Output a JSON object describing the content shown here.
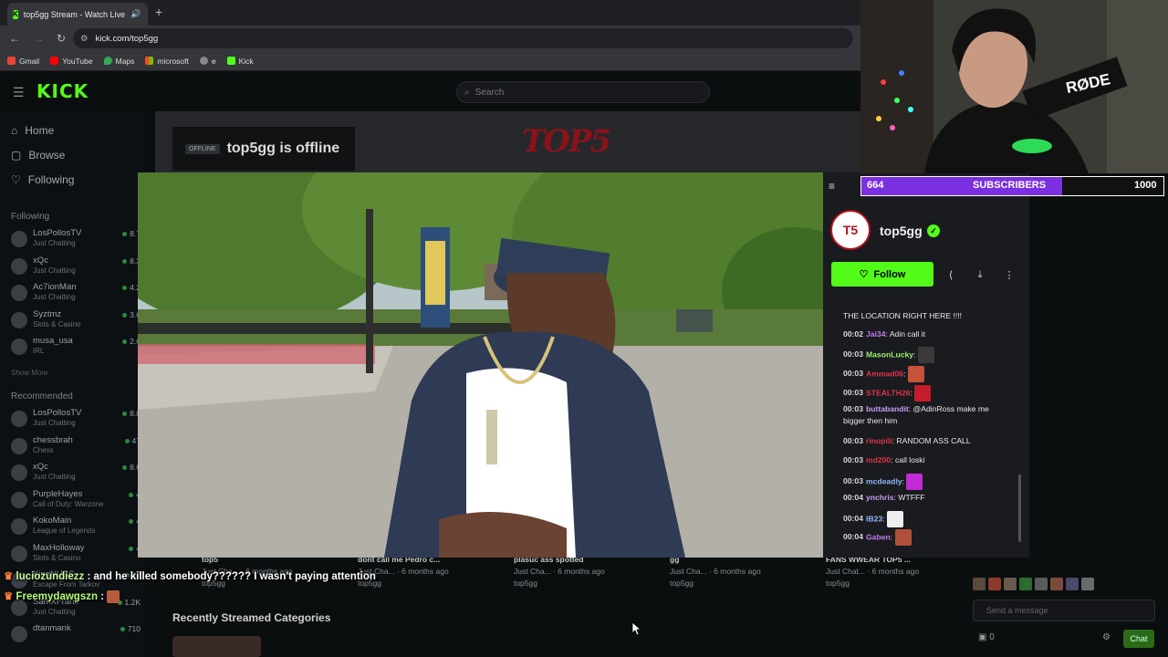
{
  "browser": {
    "tab_title": "top5gg Stream - Watch Live",
    "tab_close": "✕",
    "new_tab": "+",
    "url": "kick.com/top5gg",
    "bookmarks": [
      "Gmail",
      "YouTube",
      "Maps",
      "microsoft",
      "e",
      "Kick"
    ]
  },
  "kick": {
    "logo": "KICK",
    "search_placeholder": "Search",
    "nav": [
      "Home",
      "Browse",
      "Following"
    ],
    "following_title": "Following",
    "following": [
      {
        "name": "LosPollosTV",
        "sub": "Just Chatting",
        "viewers": "8.7"
      },
      {
        "name": "xQc",
        "sub": "Just Chatting",
        "viewers": "8.3"
      },
      {
        "name": "Ac7ionMan",
        "sub": "Just Chatting",
        "viewers": "4.2"
      },
      {
        "name": "Syztmz",
        "sub": "Slots & Casino",
        "viewers": "3.6"
      },
      {
        "name": "musa_usa",
        "sub": "IRL",
        "viewers": "2.6"
      }
    ],
    "show_more": "Show More",
    "recommended_title": "Recommended",
    "recommended": [
      {
        "name": "LosPollosTV",
        "sub": "Just Chatting",
        "viewers": "8.8"
      },
      {
        "name": "chessbrah",
        "sub": "Chess",
        "viewers": "47"
      },
      {
        "name": "xQc",
        "sub": "Just Chatting",
        "viewers": "8.6"
      },
      {
        "name": "PurpleHayes",
        "sub": "Call of Duty: Warzone",
        "viewers": "4"
      },
      {
        "name": "KokoMain",
        "sub": "League of Legends",
        "viewers": "4"
      },
      {
        "name": "MaxHolloway",
        "sub": "Slots & Casino",
        "viewers": "4"
      },
      {
        "name": "KingNUBS",
        "sub": "Escape From Tarkov",
        "viewers": "17"
      },
      {
        "name": "SamXFrank",
        "sub": "Just Chatting",
        "viewers": "1.2K"
      },
      {
        "name": "dtanmank",
        "sub": "",
        "viewers": "710"
      }
    ],
    "offline_tag": "OFFLINE",
    "offline_text": "top5gg is offline",
    "banner_logo": "TOP5",
    "recent_title": "Recently Streamed Categories"
  },
  "panel": {
    "collapse_icon": "≡",
    "avatar_text": "T5",
    "channel": "top5gg",
    "verified": "✓",
    "follow_label": "Follow",
    "chat": [
      {
        "ts": "",
        "user": "",
        "color": "#e9e9e9",
        "text": "THE LOCATION RIGHT HERE !!!!"
      },
      {
        "ts": "00:02",
        "user": "Jai34",
        "color": "#c17cf0",
        "text": "Adin call it"
      },
      {
        "ts": "00:03",
        "user": "MasonLucky",
        "color": "#9ef06a",
        "text": ""
      },
      {
        "ts": "00:03",
        "user": "Ammad06",
        "color": "#e0344a",
        "text": ""
      },
      {
        "ts": "00:03",
        "user": "STEALTH26",
        "color": "#e0344a",
        "text": ""
      },
      {
        "ts": "00:03",
        "user": "buttabandit",
        "color": "#c99cf5",
        "text": "@AdinRoss make me bigger then him"
      },
      {
        "ts": "00:03",
        "user": "rinopili",
        "color": "#e0344a",
        "text": "RANDOM ASS CALL"
      },
      {
        "ts": "00:03",
        "user": "md200",
        "color": "#e0344a",
        "text": "call loski"
      },
      {
        "ts": "00:03",
        "user": "mcdeadly",
        "color": "#8fb7ff",
        "text": ""
      },
      {
        "ts": "00:04",
        "user": "ynchris",
        "color": "#c99cf5",
        "text": "WTFFF"
      },
      {
        "ts": "00:04",
        "user": "IB23",
        "color": "#8fb7ff",
        "text": ""
      },
      {
        "ts": "00:04",
        "user": "Gaben",
        "color": "#c17cf0",
        "text": ""
      }
    ],
    "send_placeholder": "Send a message",
    "chat_button": "Chat",
    "points": "0"
  },
  "subs": {
    "current": "664",
    "label": "SUBSCRIBERS",
    "goal": "1000",
    "progress": 0.664
  },
  "videos": [
    {
      "title": "top5",
      "meta": "Just Cha... · 6 months ago",
      "channel": "top5gg"
    },
    {
      "title": "dont call me Pedro c...",
      "meta": "Just Cha... · 6 months ago",
      "channel": "top5gg"
    },
    {
      "title": "plasuc ass spotted",
      "meta": "Just Cha... · 6 months ago",
      "channel": "top5gg"
    },
    {
      "title": "gg",
      "meta": "Just Cha... · 6 months ago",
      "channel": "top5gg"
    },
    {
      "title": "FANS WWEAR TOP5 ...",
      "meta": "Just Chat... · 6 months ago",
      "channel": "top5gg"
    }
  ],
  "overlay": [
    {
      "user": "luciozundiezz",
      "text": " : and he killed somebody?????? I wasn't paying attention"
    },
    {
      "user": "Freemydawgszn",
      "text": " : "
    }
  ]
}
